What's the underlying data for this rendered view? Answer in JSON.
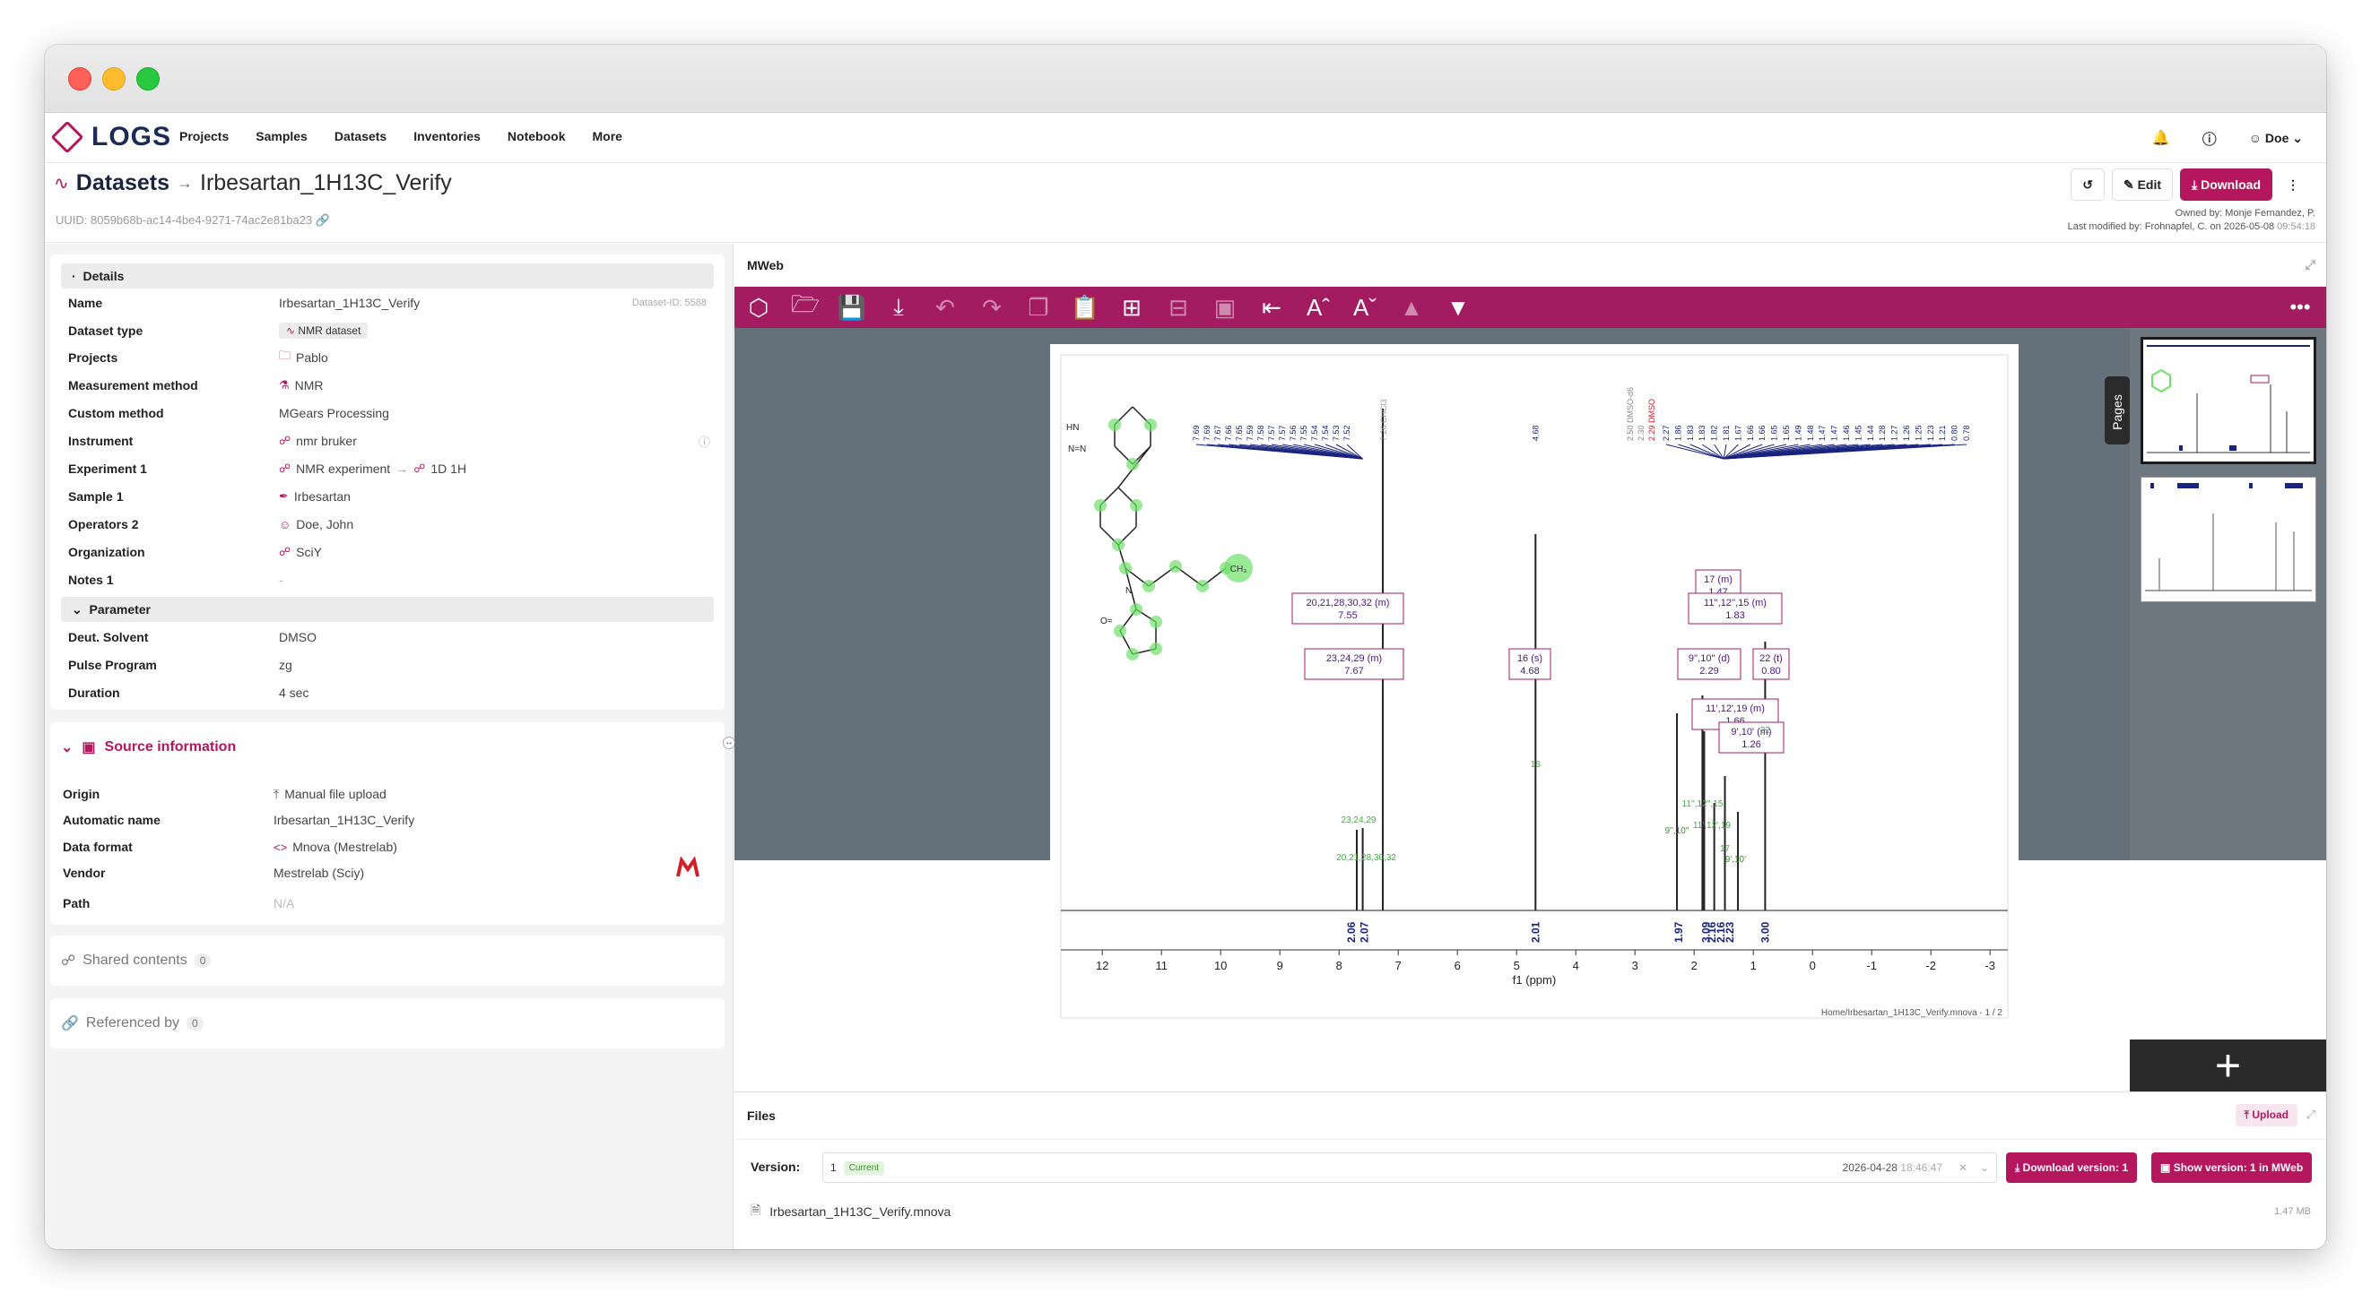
{
  "nav": {
    "logo": "LOGS",
    "items": [
      "Projects",
      "Samples",
      "Datasets",
      "Inventories",
      "Notebook",
      "More"
    ],
    "user": "Doe"
  },
  "header": {
    "section": "Datasets",
    "title": "Irbesartan_1H13C_Verify",
    "uuid": "UUID: 8059b68b-ac14-4be4-9271-74ac2e81ba23",
    "edit": "Edit",
    "download": "Download",
    "owned_by": "Owned by: Monje Fernandez, P.",
    "modified_by": "Last modified by: Frohnapfel, C. on 2026-05-08",
    "modified_time": "09:54:18"
  },
  "details": {
    "heading": "Details",
    "dataset_id": "Dataset-ID: 5588",
    "rows": [
      {
        "label": "Name",
        "value": "Irbesartan_1H13C_Verify"
      },
      {
        "label": "Dataset type",
        "value": "NMR dataset"
      },
      {
        "label": "Projects",
        "value": "Pablo"
      },
      {
        "label": "Measurement method",
        "value": "NMR"
      },
      {
        "label": "Custom method",
        "value": "MGears Processing"
      },
      {
        "label": "Instrument",
        "value": "nmr bruker"
      },
      {
        "label": "Experiment 1",
        "value": "NMR experiment",
        "value2": "1D 1H"
      },
      {
        "label": "Sample 1",
        "value": "Irbesartan"
      },
      {
        "label": "Operators 2",
        "value": "Doe, John"
      },
      {
        "label": "Organization",
        "value": "SciY"
      },
      {
        "label": "Notes 1",
        "value": "-"
      }
    ]
  },
  "parameter": {
    "heading": "Parameter",
    "rows": [
      {
        "label": "Deut. Solvent",
        "value": "DMSO"
      },
      {
        "label": "Pulse Program",
        "value": "zg"
      },
      {
        "label": "Duration",
        "value": "4 sec"
      }
    ]
  },
  "source": {
    "heading": "Source information",
    "rows": [
      {
        "label": "Origin",
        "value": "Manual file upload"
      },
      {
        "label": "Automatic name",
        "value": "Irbesartan_1H13C_Verify"
      },
      {
        "label": "Data format",
        "value": "Mnova (Mestrelab)"
      },
      {
        "label": "Vendor",
        "value": "Mestrelab (Sciy)"
      },
      {
        "label": "Path",
        "value": "N/A"
      }
    ]
  },
  "shared": {
    "label": "Shared contents",
    "count": "0"
  },
  "referenced": {
    "label": "Referenced by",
    "count": "0"
  },
  "mweb": {
    "heading": "MWeb",
    "pages_label": "Pages",
    "footer": "Home/Irbesartan_1H13C_Verify.mnova - 1 / 2",
    "xlabel": "f1 (ppm)",
    "xticks": [
      "12",
      "11",
      "10",
      "9",
      "8",
      "7",
      "6",
      "5",
      "4",
      "3",
      "2",
      "1",
      "0",
      "-1",
      "-2",
      "-3"
    ],
    "peak_labels_left": [
      "7.69",
      "7.69",
      "7.67",
      "7.66",
      "7.65",
      "7.59",
      "7.58",
      "7.57",
      "7.57",
      "7.56",
      "7.55",
      "7.54",
      "7.54",
      "7.53",
      "7.52"
    ],
    "solvent_label": "7.26 CHCl3",
    "peak_mid": "4.68",
    "dmso_labels": [
      "2.50 DMSO-d6",
      "2.30",
      "2.29 DMSO"
    ],
    "peak_labels_right": [
      "2.27",
      "1.86",
      "1.83",
      "1.83",
      "1.82",
      "1.81",
      "1.67",
      "1.66",
      "1.66",
      "1.65",
      "1.65",
      "1.49",
      "1.48",
      "1.47",
      "1.47",
      "1.46",
      "1.45",
      "1.44",
      "1.28",
      "1.27",
      "1.26",
      "1.25",
      "1.23",
      "1.21",
      "0.80",
      "0.78"
    ],
    "multiplets": [
      {
        "atoms": "20,21,28,30,32 (m)",
        "shift": "7.55"
      },
      {
        "atoms": "23,24,29 (m)",
        "shift": "7.67"
      },
      {
        "atoms": "16 (s)",
        "shift": "4.68"
      },
      {
        "atoms": "17 (m)",
        "shift": "1.47"
      },
      {
        "atoms": "11'',12'',15 (m)",
        "shift": "1.83"
      },
      {
        "atoms": "9'',10'' (d)",
        "shift": "2.29"
      },
      {
        "atoms": "22 (t)",
        "shift": "0.80"
      },
      {
        "atoms": "11',12',19 (m)",
        "shift": "1.66"
      },
      {
        "atoms": "9',10' (m)",
        "shift": "1.26"
      }
    ],
    "integrals": [
      "2.06",
      "2.07",
      "2.01",
      "1.97",
      "3.09",
      "2.16",
      "2.16",
      "2.23",
      "3.00"
    ],
    "peak_tags": [
      "23,24,29",
      "20,21,28,30,32",
      "16",
      "11'',12'',15",
      "9'',10''",
      "11',12',19",
      "17",
      "9',10'",
      "22"
    ]
  },
  "files": {
    "heading": "Files",
    "upload": "Upload",
    "version_label": "Version:",
    "version_value": "1",
    "current": "Current",
    "version_date": "2026-04-28",
    "version_time": "18:46:47",
    "download_version": "Download version: 1",
    "show_version": "Show version: 1 in MWeb",
    "file_name": "Irbesartan_1H13C_Verify.mnova",
    "file_size": "1.47 MB"
  },
  "colors": {
    "brand": "#b5175f",
    "toolbar": "#a31c62",
    "viewer_bg": "#64717b",
    "peak_label": "#1a237e",
    "assign_green": "#6ee06a"
  }
}
